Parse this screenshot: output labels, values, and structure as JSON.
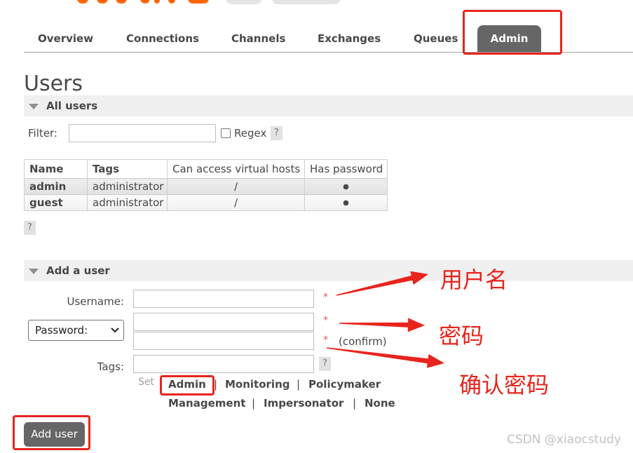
{
  "theme": {
    "active_tab_color": "#666666",
    "annotation_color": "#e8241c"
  },
  "icons": {
    "section_toggle": "triangle-down-icon",
    "select_toggle": "chevron-down-icon",
    "help": "help-icon"
  },
  "nav": {
    "tabs": [
      {
        "label": "Overview",
        "active": false
      },
      {
        "label": "Connections",
        "active": false
      },
      {
        "label": "Channels",
        "active": false
      },
      {
        "label": "Exchanges",
        "active": false
      },
      {
        "label": "Queues",
        "active": false
      },
      {
        "label": "Admin",
        "active": true
      }
    ]
  },
  "page_title": "Users",
  "all_users": {
    "section_label": "All users",
    "filter": {
      "label": "Filter:",
      "value": "",
      "regex_label": "Regex",
      "regex_checked": false
    },
    "help_label": "?",
    "table": {
      "columns": [
        "Name",
        "Tags",
        "Can access virtual hosts",
        "Has password"
      ],
      "rows": [
        {
          "name": "admin",
          "tags": "administrator",
          "vhosts": "/",
          "has_password": "●"
        },
        {
          "name": "guest",
          "tags": "administrator",
          "vhosts": "/",
          "has_password": "●"
        }
      ]
    }
  },
  "add_user": {
    "section_label": "Add a user",
    "required_mark": "*",
    "username": {
      "label": "Username:",
      "value": ""
    },
    "password": {
      "mode_selected": "Password:",
      "value": "",
      "confirm_value": "",
      "confirm_label": "(confirm)"
    },
    "tags": {
      "label": "Tags:",
      "value": "",
      "help_label": "?",
      "set_label": "Set",
      "options": [
        "Admin",
        "Monitoring",
        "Policymaker",
        "Management",
        "Impersonator",
        "None"
      ],
      "separator": "|"
    },
    "submit_label": "Add user"
  },
  "annotations": {
    "username_note": "用户名",
    "password_note": "密码",
    "confirm_note": "确认密码"
  },
  "watermark": "CSDN @xiaocstudy"
}
